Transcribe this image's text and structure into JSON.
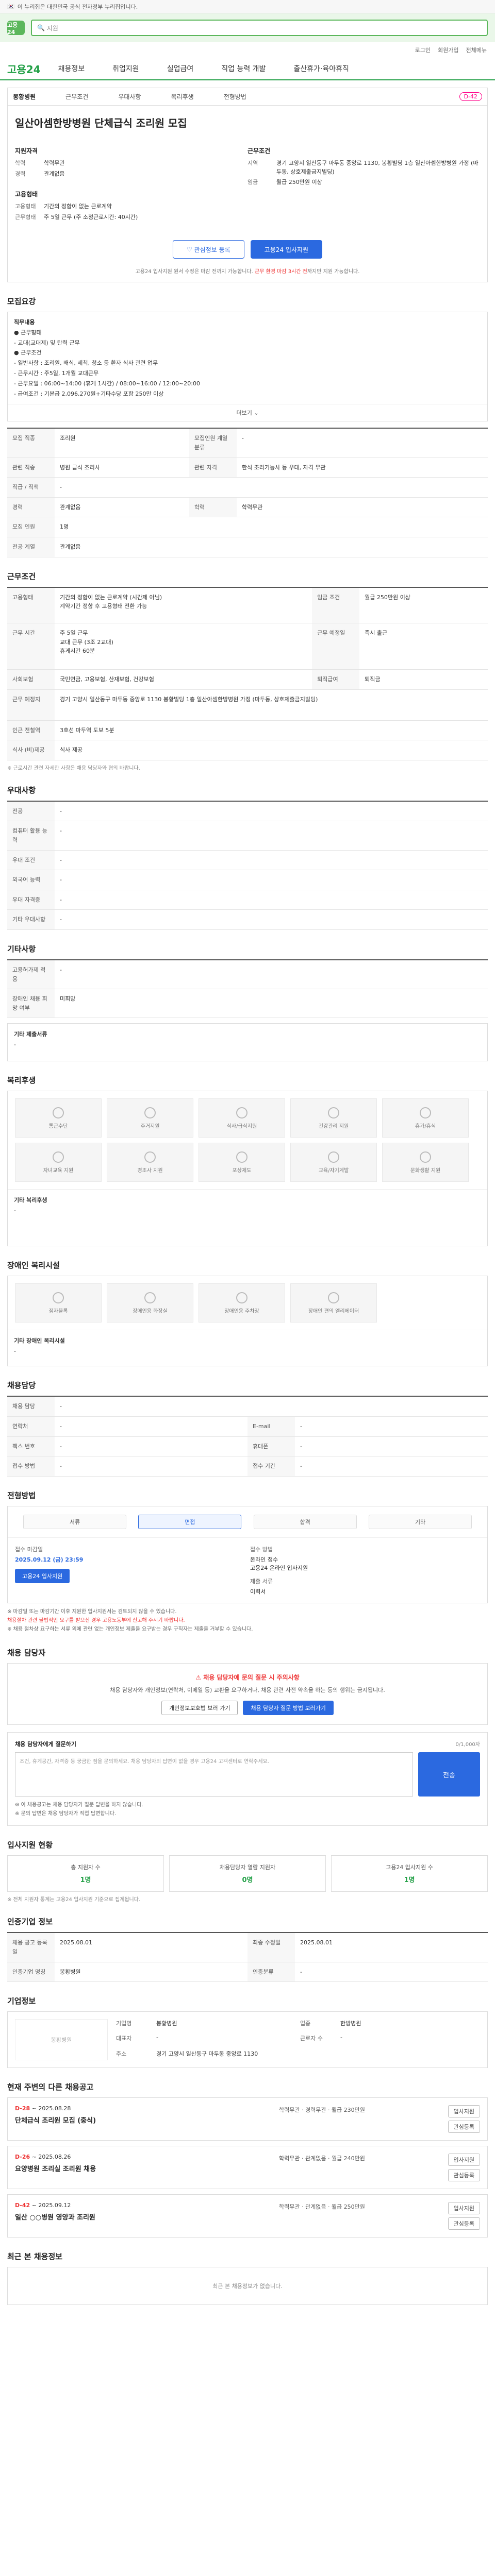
{
  "topbar": {
    "text": "이 누리집은 대한민국 공식 전자정부 누리집입니다."
  },
  "header": {
    "logo": "고용24",
    "search_placeholder": "지원",
    "util": [
      "로그인",
      "회원가입",
      "전체메뉴"
    ],
    "nav": [
      "채용정보",
      "취업지원",
      "실업급여",
      "직업 능력 개발",
      "출산휴가·육아휴직"
    ]
  },
  "summary": {
    "tabs": [
      "채용정보",
      "근무조건",
      "우대사항",
      "복리후생",
      "전형방법"
    ],
    "org": "봉황병원",
    "dday": "D-42",
    "title": "일산아셈한방병원 단체급식 조리원 모집",
    "left_title": "지원자격",
    "left": [
      {
        "k": "학력",
        "v": "학력무관"
      },
      {
        "k": "경력",
        "v": "관계없음"
      }
    ],
    "right_title": "근무조건",
    "right": [
      {
        "k": "지역",
        "v": "경기 고양시 일산동구 마두동 중앙로 1130, 봉황빌딩 1층 일산아셈한방병원 가정 (마두동, 상호제출금지빌딩)"
      },
      {
        "k": "임금",
        "v": "월급 250만원 이상"
      }
    ],
    "form_title": "고용형태",
    "form": [
      {
        "k": "고용형태",
        "v": "기간의 정함이 없는 근로계약"
      },
      {
        "k": "근무형태",
        "v": "주 5일 근무 (주 소정근로시간: 40시간)"
      }
    ],
    "btn_interest": "관심정보 등록",
    "btn_apply": "고용24 입사지원",
    "notice": "고용24 입사지원 원서 수정은 마감 전까지 가능합니다.",
    "notice_red": "근무 환경 마감 3시간 전",
    "notice_tail": "까지만 지원 가능합니다."
  },
  "recruit": {
    "title": "모집요강",
    "duty_head": "직무내용",
    "duty": [
      "● 근무형태",
      "   - 교대(교대제) 및 탄력 근무",
      "● 근무조건",
      "   - 일반사항 : 조리원, 배식, 세척, 청소 등 환자 식사 관련 업무",
      "   - 근무시간 : 주5일, 1개월 교대근무",
      "   - 근무요일 : 06:00~14:00 (휴게 1시간) / 08:00~16:00 / 12:00~20:00",
      "   - 급여조건 : 기본급 2,096,270원+기타수당 포함 250만 이상"
    ],
    "more": "더보기",
    "rows": [
      [
        "모집 직종",
        "조리원",
        "모집인원 계열 분류",
        "-"
      ],
      [
        "관련 직종",
        "병원 급식 조리사",
        "관련 자격",
        "한식 조리기능사 등 우대, 자격 무관"
      ],
      [
        "직급 / 직책",
        "-",
        "",
        ""
      ],
      [
        "경력",
        "관계없음",
        "학력",
        "학력무관"
      ],
      [
        "모집 인원",
        "1명",
        "",
        ""
      ],
      [
        "전공 계열",
        "관계없음",
        "",
        ""
      ]
    ]
  },
  "work": {
    "title": "근무조건",
    "rows": [
      [
        "고용형태",
        "기간의 정함이 없는 근로계약 (시간제 아님)\n계약기간 정함 후 고용형태 전환 가능",
        "임금 조건",
        "월급 250만원 이상"
      ],
      [
        "근무 시간",
        "주 5일 근무\n교대 근무 (3조 2교대)\n휴게시간 60분",
        "근무 예정일",
        "즉시 출근"
      ],
      [
        "사회보험",
        "국민연금, 고용보험, 산재보험, 건강보험",
        "퇴직급여",
        "퇴직금"
      ],
      [
        "근무 예정지",
        "경기 고양시 일산동구 마두동 중앙로 1130 봉황빌딩 1층 일산아셈한방병원 가정 (마두동, 상호제출금지빌딩)",
        "",
        ""
      ],
      [
        "인근 전철역",
        "3호선 마두역 도보 5분",
        "",
        ""
      ],
      [
        "식사 (비)제공",
        "식사 제공",
        "",
        ""
      ]
    ],
    "foot": "※ 근로시간 관련 자세한 사항은 채용 담당자와 협의 바랍니다."
  },
  "prefer": {
    "title": "우대사항",
    "rows": [
      [
        "전공",
        "-"
      ],
      [
        "컴퓨터 활용 능력",
        "-"
      ],
      [
        "우대 조건",
        "-"
      ],
      [
        "외국어 능력",
        "-"
      ],
      [
        "우대 자격증",
        "-"
      ],
      [
        "기타 우대사항",
        "-"
      ]
    ]
  },
  "doc": {
    "title": "기타사항",
    "rows": [
      [
        "고용허가제 적용",
        "-"
      ],
      [
        "장애인 채용 희망 여부",
        "미희망"
      ]
    ],
    "extra_head": "기타 제출서류",
    "extra_val": "-"
  },
  "welfare": {
    "title": "복리후생",
    "items": [
      "통근수단",
      "주거지원",
      "식사/급식지원",
      "건강관리 지원",
      "휴가/휴식",
      "자녀교육 지원",
      "경조사 지원",
      "포상제도",
      "교육/자기계발",
      "문화생활 지원"
    ],
    "etc_head": "기타 복리후생",
    "etc_val": "-"
  },
  "disabled": {
    "title": "장애인 복리시설",
    "items": [
      "점자블록",
      "장애인용 화장실",
      "장애인용 주차장",
      "장애인 편의 엘리베이터"
    ],
    "etc_head": "기타 장애인 복리시설",
    "etc_val": "-"
  },
  "hr": {
    "title": "채용담당",
    "rows": [
      [
        "채용 담당",
        "-",
        "",
        ""
      ],
      [
        "연락처",
        "-",
        "E-mail",
        "-"
      ],
      [
        "팩스 번호",
        "-",
        "휴대폰",
        "-"
      ],
      [
        "접수 방법",
        "-",
        "접수 기간",
        "-"
      ]
    ]
  },
  "process": {
    "title": "전형방법",
    "steps": [
      "서류",
      "면접",
      "합격",
      "기타"
    ],
    "apply_period_lbl": "접수 마감일",
    "apply_period_val": "2025.09.12 (금) 23:59",
    "apply_method_lbl": "접수 방법",
    "apply_method_val": "온라인 접수\n고용24 온라인 입사지원",
    "chip": "고용24 입사지원",
    "submit_lbl": "제출 서류",
    "submit_val": "이력서",
    "warn1": "※ 마감일 또는 마감기간 이후 지원한 입사지원서는 검토되지 않을 수 있습니다.",
    "warn_red": "채용절차 관련 불법적인 요구를 받으신 경우 고용노동부에 신고해 주시기 바랍니다.",
    "warn2": "※ 채용 절차상 요구하는 서류 외에 관련 없는 개인정보 제출을 요구받는 경우 구직자는 제출을 거부할 수 있습니다."
  },
  "qa": {
    "title": "채용 담당자",
    "alert_title": "채용 담당자에 문의 질문 시 주의사항",
    "alert_desc": "채용 담당자와 개인정보(연락처, 이메일 등) 교환을 요구하거나, 채용 관련 사전 약속을 하는 등의 행위는 금지됩니다.",
    "btn1": "개인정보보호법 보러 가기",
    "btn2": "채용 담당자 질문 방법 보러가기",
    "q_title": "채용 담당자에게 질문하기",
    "q_limit": "0/1,000자",
    "q_placeholder": "조건, 휴게공간, 자격증 등 궁금한 점을 문의하세요. 채용 담당자의 답변이 없을 경우 고용24 고객센터로 연락주세요.",
    "q_send": "전송",
    "q_notes": [
      "※ 이 채용공고는 채용 담당자가 질문 답변을 하지 않습니다.",
      "※ 문의 답변은 채용 담당자가 직접 답변합니다."
    ]
  },
  "status": {
    "title": "입사지원 현황",
    "items": [
      {
        "k": "총 지원자 수",
        "v": "1명"
      },
      {
        "k": "채용담당자 열람 지원자",
        "v": "0명"
      },
      {
        "k": "고용24 입사지원 수",
        "v": "1명"
      }
    ],
    "note": "※ 전체 지원자 통계는 고용24 입사지원 기준으로 집계됩니다."
  },
  "info": {
    "title": "인증기업 정보",
    "rows": [
      [
        "채용 공고 등록일",
        "2025.08.01",
        "최종 수정일",
        "2025.08.01"
      ],
      [
        "인증기업 명칭",
        "봉황병원",
        "인증분류",
        "-"
      ]
    ]
  },
  "company": {
    "title": "기업정보",
    "logo": "봉황병원",
    "rows": [
      [
        "기업명",
        "봉황병원",
        "업종",
        "한방병원"
      ],
      [
        "대표자",
        "-",
        "근로자 수",
        "-"
      ],
      [
        "주소",
        "경기 고양시 일산동구 마두동 중앙로 1130",
        "",
        ""
      ]
    ]
  },
  "similar": {
    "title": "현재 주변의 다른 채용공고",
    "items": [
      {
        "dday": "D-28",
        "date": "~ 2025.08.28",
        "name": "단체급식 조리원 모집 (중식)",
        "meta": "학력무관 · 경력무관 · 월급 230만원",
        "btn1": "입사지원",
        "btn2": "관심등록"
      },
      {
        "dday": "D-26",
        "date": "~ 2025.08.26",
        "name": "요양병원 조리실 조리원 채용",
        "meta": "학력무관 · 관계없음 · 월급 240만원",
        "btn1": "입사지원",
        "btn2": "관심등록"
      },
      {
        "dday": "D-42",
        "date": "~ 2025.09.12",
        "name": "일산 ○○병원 영양과 조리원",
        "meta": "학력무관 · 관계없음 · 월급 250만원",
        "btn1": "입사지원",
        "btn2": "관심등록"
      }
    ]
  },
  "recent": {
    "title": "최근 본 채용정보",
    "empty": "최근 본 채용정보가 없습니다."
  }
}
